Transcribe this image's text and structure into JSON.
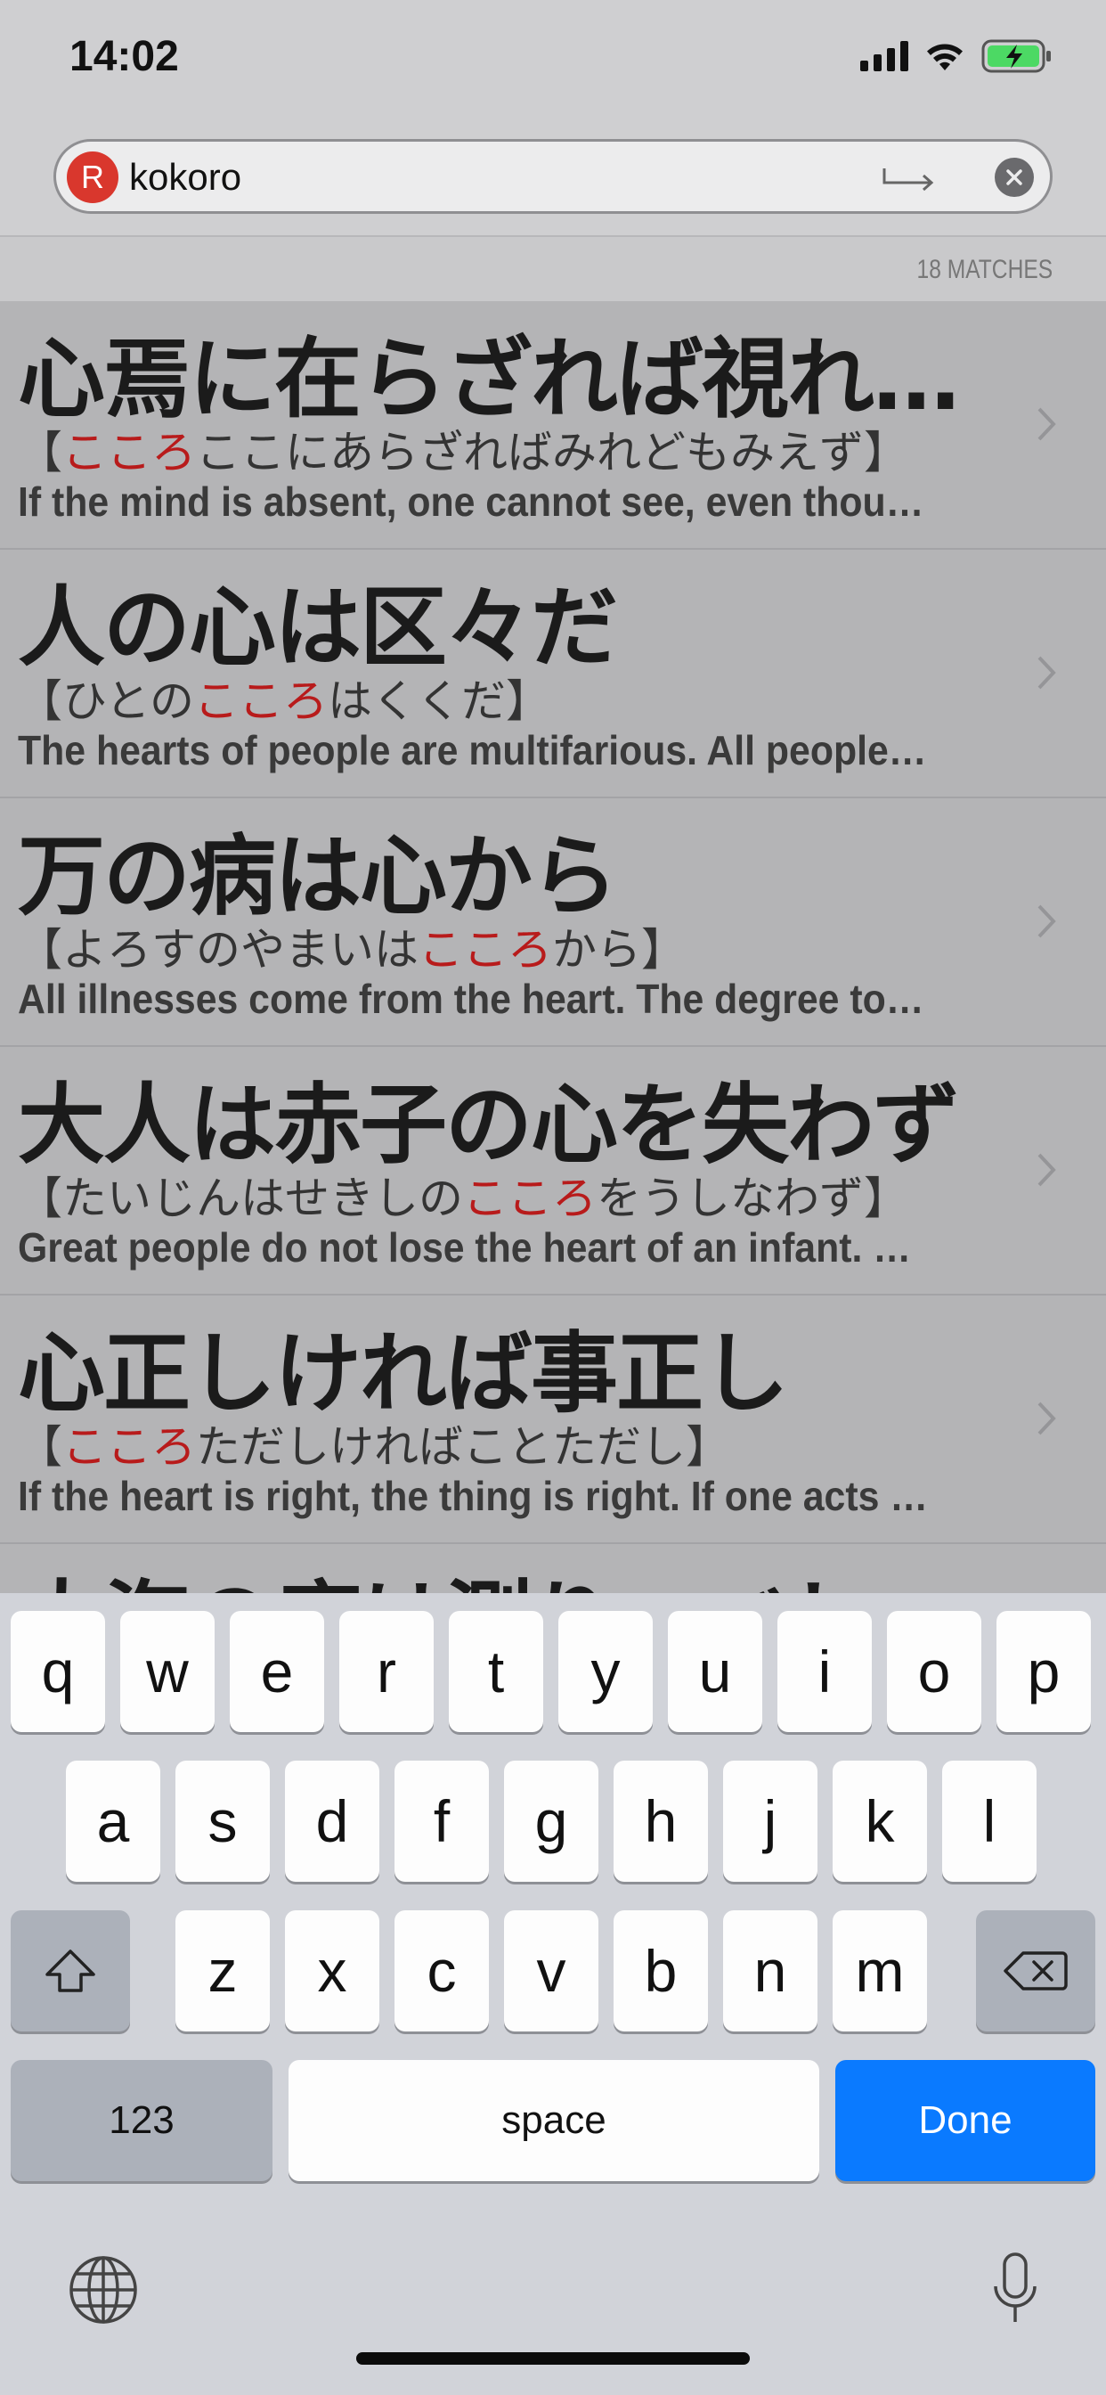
{
  "status": {
    "time": "14:02"
  },
  "search": {
    "badge": "R",
    "value": "kokoro"
  },
  "matches": "18 MATCHES",
  "colors": {
    "accent_red": "#b81b1b",
    "done_blue": "#0a7aff",
    "battery_green": "#4cd964"
  },
  "results": [
    {
      "title": "心焉に在らざれば視れ…",
      "reading": {
        "pre": "【",
        "hl": "こころ",
        "post": "ここにあらざればみれどもみえず】"
      },
      "english": "If the mind is absent, one cannot see, even though…"
    },
    {
      "title": "人の心は区々だ",
      "reading": {
        "pre": "【ひとの",
        "hl": "こころ",
        "post": "はくくだ】"
      },
      "english": "The hearts of people are multifarious. All people ar…"
    },
    {
      "title": "万の病は心から",
      "reading": {
        "pre": "【よろすのやまいは",
        "hl": "こころ",
        "post": "から】"
      },
      "english": "All illnesses come from the heart. The degree to w…"
    },
    {
      "title": "大人は赤子の心を失わず",
      "reading": {
        "pre": "【たいじんはせきしの",
        "hl": "こころ",
        "post": "をうしなわず】"
      },
      "english": "Great people do not lose the heart of an infant. Thi…"
    },
    {
      "title": "心正しければ事正し",
      "reading": {
        "pre": "【",
        "hl": "こころ",
        "post": "ただしければことただし】"
      },
      "english": "If the heart is right, the thing is right. If one acts fo…"
    },
    {
      "title": "大海の底は測りつべし",
      "reading": {
        "pre": "",
        "hl": "",
        "post": ""
      },
      "english": ""
    }
  ],
  "keyboard": {
    "row1": [
      "q",
      "w",
      "e",
      "r",
      "t",
      "y",
      "u",
      "i",
      "o",
      "p"
    ],
    "row2": [
      "a",
      "s",
      "d",
      "f",
      "g",
      "h",
      "j",
      "k",
      "l"
    ],
    "row3": [
      "z",
      "x",
      "c",
      "v",
      "b",
      "n",
      "m"
    ],
    "numbers_label": "123",
    "space_label": "space",
    "done_label": "Done",
    "shift_icon": "shift-icon",
    "delete_icon": "delete-icon",
    "globe_icon": "globe-icon",
    "mic_icon": "microphone-icon"
  }
}
